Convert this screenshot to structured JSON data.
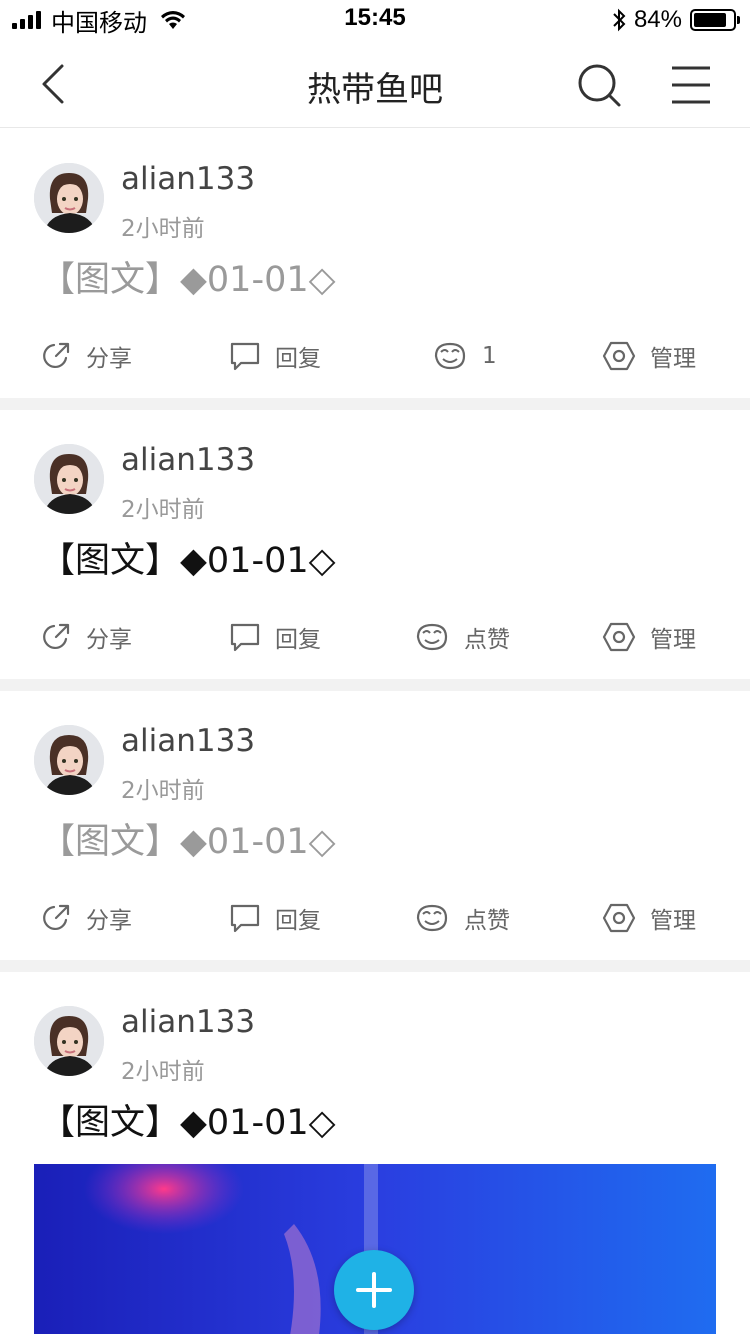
{
  "status_bar": {
    "carrier": "中国移动",
    "time": "15:45",
    "battery_percent": "84%",
    "battery_level": 0.84
  },
  "nav": {
    "title": "热带鱼吧",
    "back_icon": "chevron-left-icon",
    "search_icon": "search-icon",
    "menu_icon": "menu-icon"
  },
  "actions": {
    "share": "分享",
    "reply": "回复",
    "like": "点赞",
    "manage": "管理"
  },
  "posts": [
    {
      "username": "alian133",
      "time": "2小时前",
      "title": "【图文】◆01-01◇",
      "read": true,
      "likes": "1"
    },
    {
      "username": "alian133",
      "time": "2小时前",
      "title": "【图文】◆01-01◇",
      "read": false
    },
    {
      "username": "alian133",
      "time": "2小时前",
      "title": "【图文】◆01-01◇",
      "read": true
    },
    {
      "username": "alian133",
      "time": "2小时前",
      "title": "【图文】◆01-01◇",
      "read": false,
      "has_image": true
    }
  ],
  "colors": {
    "accent": "#1fb2e6",
    "divider": "#f2f2f2",
    "read_title": "#9a9a9a",
    "unread_title": "#111111"
  }
}
